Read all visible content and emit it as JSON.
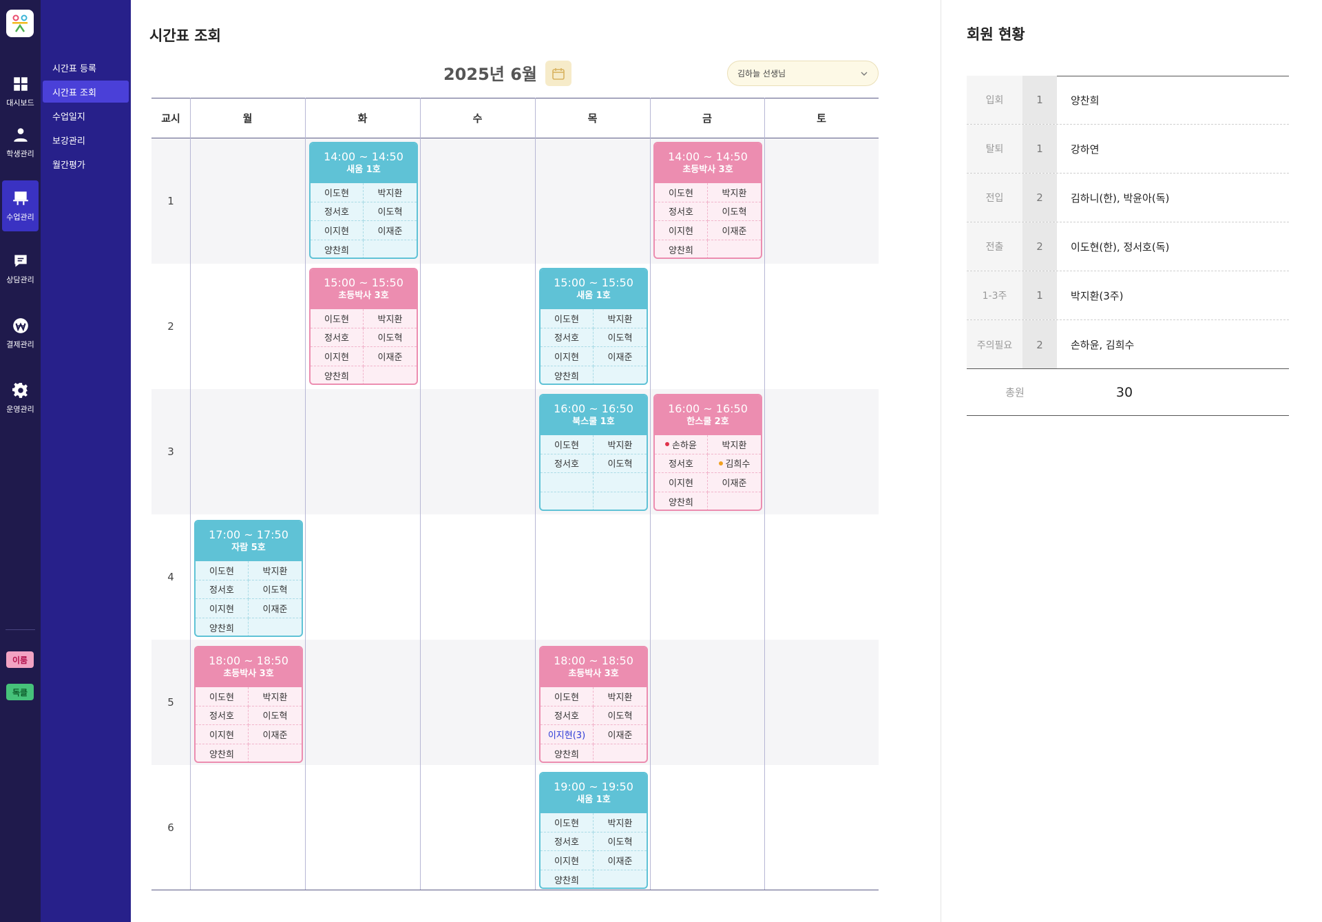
{
  "app": {
    "logo_text": "ㅎㅎ ㅅ"
  },
  "nav": [
    {
      "label": "대시보드",
      "icon": "dashboard-icon"
    },
    {
      "label": "학생관리",
      "icon": "student-icon"
    },
    {
      "label": "수업관리",
      "icon": "class-icon"
    },
    {
      "label": "상담관리",
      "icon": "chat-icon"
    },
    {
      "label": "결제관리",
      "icon": "won-icon"
    },
    {
      "label": "운영관리",
      "icon": "gear-icon"
    }
  ],
  "tags": {
    "left": "이룸",
    "right": "독클"
  },
  "submenu": [
    "시간표 등록",
    "시간표 조회",
    "수업일지",
    "보강관리",
    "월간평가"
  ],
  "page": {
    "title": "시간표 조회",
    "month": "2025년 6월",
    "teacher": "김하늘 선생님"
  },
  "grid": {
    "header": [
      "교시",
      "월",
      "화",
      "수",
      "목",
      "금",
      "토"
    ],
    "periods": [
      "1",
      "2",
      "3",
      "4",
      "5",
      "6"
    ]
  },
  "cards": [
    {
      "time": "14:00 ~ 14:50",
      "name": "새움 1호",
      "students": [
        "이도현",
        "박지환",
        "정서호",
        "이도혁",
        "이지현",
        "이재준",
        "양찬희",
        ""
      ]
    },
    {
      "time": "14:00 ~ 14:50",
      "name": "초등박사 3호",
      "students": [
        "이도현",
        "박지환",
        "정서호",
        "이도혁",
        "이지현",
        "이재준",
        "양찬희",
        ""
      ]
    },
    {
      "time": "15:00 ~ 15:50",
      "name": "초등박사 3호",
      "students": [
        "이도현",
        "박지환",
        "정서호",
        "이도혁",
        "이지현",
        "이재준",
        "양찬희",
        ""
      ]
    },
    {
      "time": "15:00 ~ 15:50",
      "name": "새움 1호",
      "students": [
        "이도현",
        "박지환",
        "정서호",
        "이도혁",
        "이지현",
        "이재준",
        "양찬희",
        ""
      ]
    },
    {
      "time": "16:00 ~ 16:50",
      "name": "북스쿨 1호",
      "students": [
        "이도현",
        "박지환",
        "정서호",
        "이도혁",
        "",
        "",
        "",
        ""
      ]
    },
    {
      "time": "16:00 ~ 16:50",
      "name": "한스쿨 2호",
      "students": [
        "손하윤",
        "박지환",
        "정서호",
        "김희수",
        "이지현",
        "이재준",
        "양찬희",
        ""
      ]
    },
    {
      "time": "17:00 ~ 17:50",
      "name": "자람 5호",
      "students": [
        "이도현",
        "박지환",
        "정서호",
        "이도혁",
        "이지현",
        "이재준",
        "양찬희",
        ""
      ]
    },
    {
      "time": "18:00 ~ 18:50",
      "name": "초등박사 3호",
      "students": [
        "이도현",
        "박지환",
        "정서호",
        "이도혁",
        "이지현",
        "이재준",
        "양찬희",
        ""
      ]
    },
    {
      "time": "18:00 ~ 18:50",
      "name": "초등박사 3호",
      "students": [
        "이도현",
        "박지환",
        "정서호",
        "이도혁",
        "이지현(3)",
        "이재준",
        "양찬희",
        ""
      ]
    },
    {
      "time": "19:00 ~ 19:50",
      "name": "새움 1호",
      "students": [
        "이도현",
        "박지환",
        "정서호",
        "이도혁",
        "이지현",
        "이재준",
        "양찬희",
        ""
      ]
    }
  ],
  "colors": {
    "blue_card": "#5fc2d6",
    "pink_card": "#ec8db0",
    "dot_red": "#e0324b",
    "dot_orange": "#f0a020",
    "highlight": "#2b3bd6",
    "sidebar": "#1f1a4c",
    "submenu": "#27208a",
    "active": "#3a32c2"
  },
  "members": {
    "title": "회원 현황",
    "rows": [
      {
        "label": "입회",
        "count": "1",
        "names": "양찬희"
      },
      {
        "label": "탈퇴",
        "count": "1",
        "names": "강하연"
      },
      {
        "label": "전입",
        "count": "2",
        "names": "김하니(한), 박윤아(독)"
      },
      {
        "label": "전출",
        "count": "2",
        "names": "이도현(한), 정서호(독)"
      },
      {
        "label": "1-3주",
        "count": "1",
        "names": "박지환(3주)"
      },
      {
        "label": "주의필요",
        "count": "2",
        "names": "손하윤, 김희수"
      }
    ],
    "total_label": "총원",
    "total": "30"
  }
}
